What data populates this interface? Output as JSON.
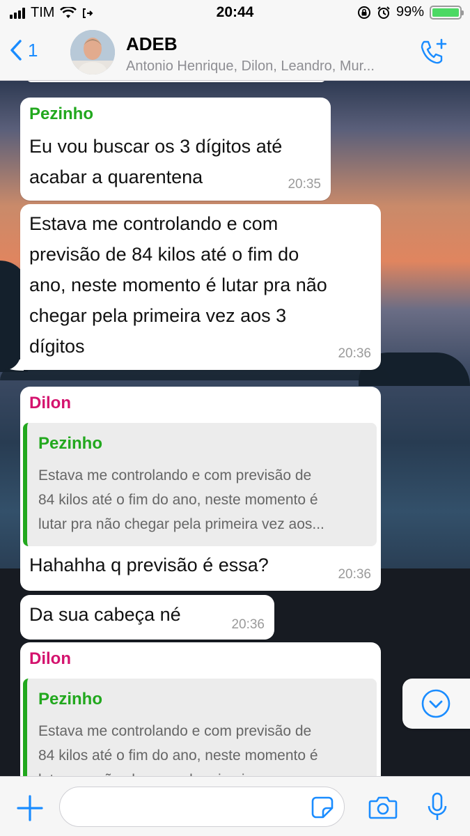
{
  "status_bar": {
    "carrier": "TIM",
    "time": "20:44",
    "battery_percent": "99%",
    "battery_level": 0.99
  },
  "header": {
    "back_count": "1",
    "title": "ADEB",
    "subtitle": "Antonio Henrique, Dilon, Leandro, Mur..."
  },
  "messages": [
    {
      "sender": "Pezinho",
      "sender_color": "#22a81e",
      "lines": [
        "Eu vou buscar os 3 dígitos até",
        "acabar a quarentena"
      ],
      "time": "20:35"
    },
    {
      "lines": [
        "Estava me controlando e com",
        "previsão de 84 kilos até o fim do",
        "ano, neste momento é lutar pra não",
        "chegar pela primeira vez aos 3",
        "dígitos"
      ],
      "time": "20:36"
    },
    {
      "sender": "Dilon",
      "sender_color": "#d4136e",
      "quote": {
        "name": "Pezinho",
        "lines": [
          "Estava me controlando e com previsão de",
          "84 kilos até o fim do ano, neste momento é",
          "lutar pra não chegar pela primeira vez aos..."
        ]
      },
      "text": "Hahahha q previsão é essa?",
      "time": "20:36"
    },
    {
      "text": "Da sua cabeça né",
      "time": "20:36"
    },
    {
      "sender": "Dilon",
      "sender_color": "#d4136e",
      "quote": {
        "name": "Pezinho",
        "lines": [
          "Estava me controlando e com previsão de",
          "84 kilos até o fim do ano, neste momento é",
          "lutar pra não chegar pela primeira vez aos..."
        ]
      }
    }
  ],
  "icons": {
    "back": "chevron-left-icon",
    "call": "add-call-icon",
    "scroll": "chevron-down-circle-icon",
    "attach": "plus-icon",
    "sticker": "sticker-icon",
    "camera": "camera-icon",
    "mic": "microphone-icon"
  },
  "colors": {
    "accent": "#1a8cff",
    "pezinho": "#22a81e",
    "dilon": "#d4136e"
  }
}
